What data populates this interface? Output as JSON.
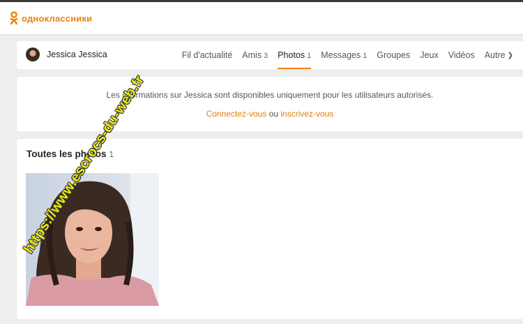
{
  "app": {
    "logo_text": "одноклассники",
    "brand_color": "#ee8208"
  },
  "profile": {
    "name": "Jessica Jessica"
  },
  "nav": {
    "items": [
      {
        "label": "Fil d'actualité",
        "count": ""
      },
      {
        "label": "Amis",
        "count": "3"
      },
      {
        "label": "Photos",
        "count": "1",
        "active": true
      },
      {
        "label": "Messages",
        "count": "1"
      },
      {
        "label": "Groupes",
        "count": ""
      },
      {
        "label": "Jeux",
        "count": ""
      },
      {
        "label": "Vidéos",
        "count": ""
      },
      {
        "label": "Autre",
        "count": ""
      }
    ]
  },
  "notice": {
    "text": "Les informations sur Jessica sont disponibles uniquement pour les utilisateurs autorisés.",
    "login_link": "Connectez-vous",
    "or_word": "ou",
    "signup_link": "inscrivez-vous"
  },
  "photos": {
    "title": "Toutes les photos",
    "count": "1"
  },
  "watermark": {
    "text": "https://www.escrocs-du-web.fr"
  }
}
